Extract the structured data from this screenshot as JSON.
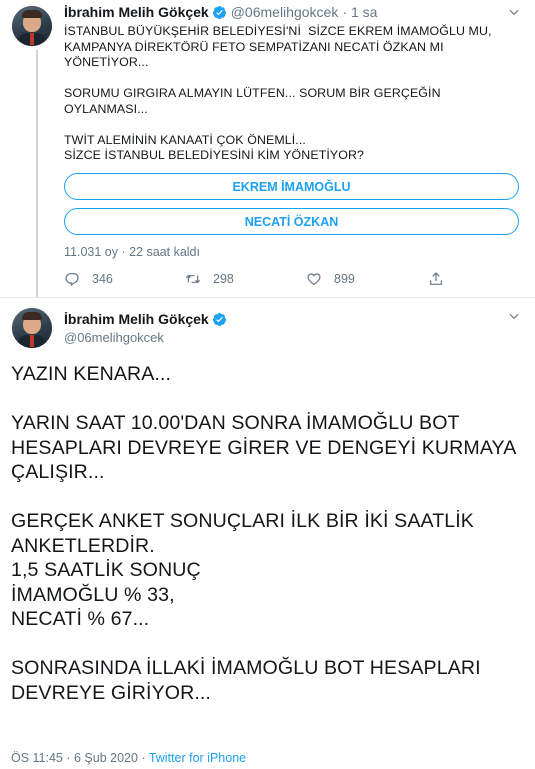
{
  "tweet1": {
    "author_name": "İbrahim Melih Gökçek",
    "handle": "@06melihgokcek",
    "separator": "·",
    "time": "1 sa",
    "text": "İSTANBUL BÜYÜKŞEHİR BELEDİYESİ'Nİ  SİZCE EKREM İMAMOĞLU MU,\nKAMPANYA DİREKTÖRÜ FETO SEMPATİZANI NECATİ ÖZKAN MI\nYÖNETİYOR...\n\nSORUMU GIRGIRA ALMAYIN LÜTFEN... SORUM BİR GERÇEĞİN OYLANMASI...\n\nTWİT ALEMİNİN KANAATİ ÇOK ÖNEMLİ...\nSİZCE İSTANBUL BELEDİYESİNİ KİM YÖNETİYOR?",
    "poll": {
      "options": [
        "EKREM İMAMOĞLU",
        "NECATİ ÖZKAN"
      ],
      "meta": "11.031 oy · 22 saat kaldı"
    },
    "actions": {
      "reply_count": "346",
      "retweet_count": "298",
      "like_count": "899"
    }
  },
  "tweet2": {
    "author_name": "İbrahim Melih Gökçek",
    "handle": "@06melihgokcek",
    "text": "YAZIN KENARA...\n\nYARIN SAAT 10.00'DAN SONRA İMAMOĞLU BOT\nHESAPLARI DEVREYE GİRER VE DENGEYİ KURMAYA\nÇALIŞIR...\n\nGERÇEK ANKET SONUÇLARI İLK BİR İKİ SAATLİK\nANKETLERDİR.\n1,5 SAATLİK SONUÇ\nİMAMOĞLU % 33,\nNECATİ % 67...\n\nSONRASINDA İLLAKİ İMAMOĞLU BOT HESAPLARI\nDEVREYE GİRİYOR...",
    "meta_time": "ÖS 11:45 · 6 Şub 2020 · ",
    "meta_source": "Twitter for iPhone"
  },
  "icons": {
    "verified": "verified-badge-icon",
    "chevron": "chevron-down-icon",
    "reply": "reply-icon",
    "retweet": "retweet-icon",
    "like": "heart-icon",
    "share": "share-icon"
  },
  "colors": {
    "accent": "#1da1f2",
    "muted": "#657786",
    "text": "#14171a",
    "thread_line": "#ccd6dd"
  }
}
